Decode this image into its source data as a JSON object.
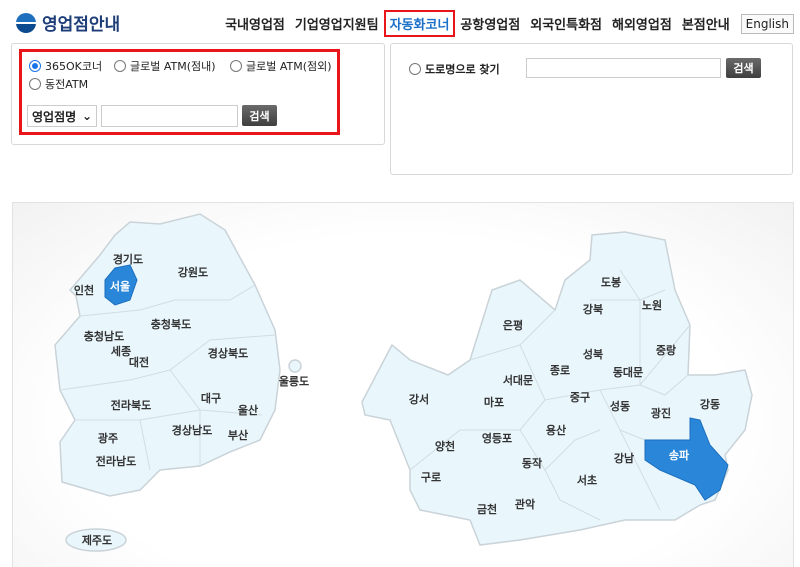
{
  "header": {
    "logo_text": "영업점안내",
    "nav": [
      "국내영업점",
      "기업영업지원팀",
      "자동화코너",
      "공항영업점",
      "외국인특화점",
      "해외영업점",
      "본점안내"
    ],
    "active_nav": "자동화코너",
    "english": "English"
  },
  "search_left": {
    "radios": [
      "365OK코너",
      "글로벌 ATM(점내)",
      "글로벌 ATM(점외)",
      "동전ATM"
    ],
    "selected": "365OK코너",
    "select_value": "영업점명",
    "input_value": "",
    "button": "검색"
  },
  "search_right": {
    "radio": "도로명으로 찾기",
    "input_value": "",
    "button": "검색"
  },
  "colors": {
    "accent": "#1a6fc8",
    "highlight": "#e8161b",
    "selected_region": "#2a86d8",
    "region_fill": "#e9f6fc"
  },
  "korea_map": {
    "regions": [
      "경기도",
      "강원도",
      "인천",
      "서울",
      "충청남도",
      "충청북도",
      "세종",
      "대전",
      "경상북도",
      "울릉도",
      "대구",
      "전라북도",
      "울산",
      "경상남도",
      "부산",
      "광주",
      "전라남도",
      "제주도"
    ],
    "selected": "서울"
  },
  "seoul_map": {
    "regions": [
      "도봉",
      "노원",
      "강북",
      "은평",
      "중랑",
      "성북",
      "종로",
      "동대문",
      "서대문",
      "강서",
      "마포",
      "중구",
      "성동",
      "광진",
      "강동",
      "양천",
      "영등포",
      "용산",
      "강남",
      "송파",
      "동작",
      "구로",
      "서초",
      "금천",
      "관악"
    ],
    "selected": "송파"
  }
}
